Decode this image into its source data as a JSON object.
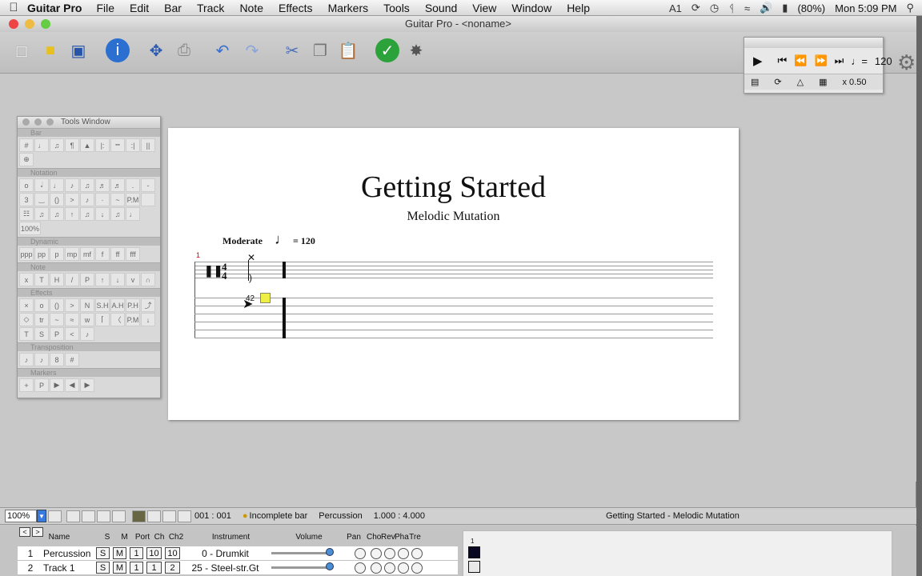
{
  "menubar": {
    "apple": "",
    "app": "Guitar Pro",
    "items": [
      "File",
      "Edit",
      "Bar",
      "Track",
      "Note",
      "Effects",
      "Markers",
      "Tools",
      "Sound",
      "View",
      "Window",
      "Help"
    ],
    "status": {
      "battery": "(80%)",
      "clock": "Mon 5:09 PM",
      "input_count": "1"
    }
  },
  "window": {
    "title": "Guitar Pro - <noname>"
  },
  "score": {
    "title": "Getting Started",
    "subtitle": "Melodic Mutation",
    "tempo_label": "Moderate",
    "tempo_value": "= 120",
    "bar_number": "1",
    "time_sig_top": "4",
    "time_sig_bottom": "4",
    "tab_fret": "42"
  },
  "tools_window": {
    "title": "Tools Window",
    "sections": [
      "Bar",
      "Notation",
      "Dynamic",
      "Note",
      "Effects",
      "Transposition",
      "Markers"
    ],
    "percent_label": "100%"
  },
  "player": {
    "tempo": "120",
    "speed": "x 0.50"
  },
  "statusbar": {
    "zoom": "100%",
    "position": "001 : 001",
    "warning": "Incomplete bar",
    "instrument": "Percussion",
    "time": "1.000 : 4.000",
    "song": "Getting Started - Melodic Mutation"
  },
  "tracks": {
    "headers": {
      "name": "Name",
      "s": "S",
      "m": "M",
      "port": "Port",
      "ch": "Ch",
      "ch2": "Ch2",
      "instrument": "Instrument",
      "volume": "Volume",
      "pan": "Pan",
      "cho": "Cho",
      "rev": "Rev",
      "pha": "Pha",
      "tre": "Tre"
    },
    "nav_prev": "<",
    "nav_next": ">",
    "rows": [
      {
        "num": "1",
        "name": "Percussion",
        "s": "S",
        "m": "M",
        "port": "1",
        "ch": "10",
        "ch2": "10",
        "instrument": "0 - Drumkit"
      },
      {
        "num": "2",
        "name": "Track 1",
        "s": "S",
        "m": "M",
        "port": "1",
        "ch": "1",
        "ch2": "2",
        "instrument": "25 - Steel-str.Gt"
      }
    ],
    "timeline_bar": "1"
  }
}
